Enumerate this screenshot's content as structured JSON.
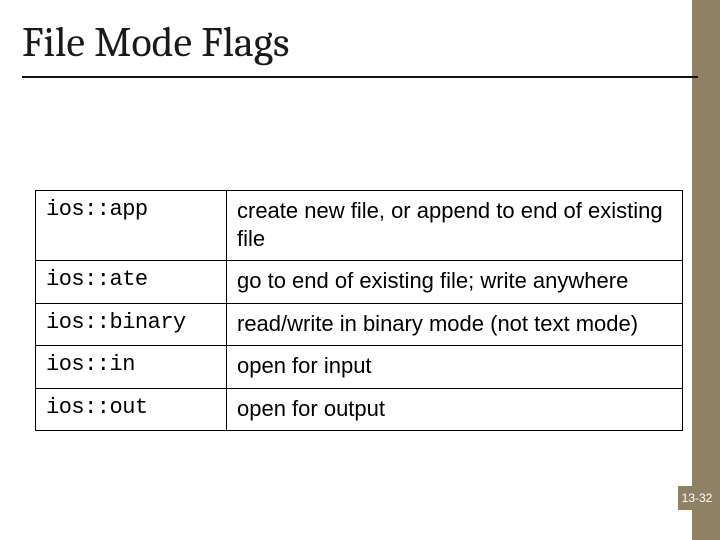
{
  "title": "File Mode Flags",
  "table": {
    "rows": [
      {
        "flag": "ios::app",
        "desc": "create new file, or append to end of existing file"
      },
      {
        "flag": "ios::ate",
        "desc": "go to end of existing file; write anywhere"
      },
      {
        "flag": "ios::binary",
        "desc": "read/write in binary mode (not text mode)"
      },
      {
        "flag": "ios::in",
        "desc": "open for input"
      },
      {
        "flag": "ios::out",
        "desc": "open for output"
      }
    ]
  },
  "page_number": "13-32",
  "colors": {
    "accent": "#8e8164"
  }
}
